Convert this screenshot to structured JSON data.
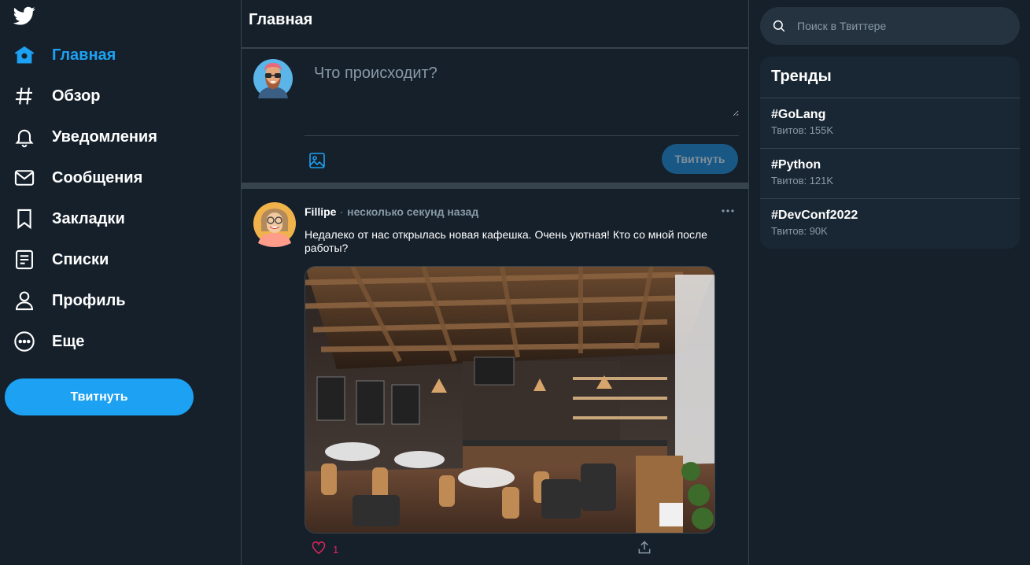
{
  "nav": {
    "items": [
      {
        "label": "Главная",
        "icon": "home-icon",
        "active": true
      },
      {
        "label": "Обзор",
        "icon": "hashtag-icon"
      },
      {
        "label": "Уведомления",
        "icon": "bell-icon"
      },
      {
        "label": "Сообщения",
        "icon": "mail-icon"
      },
      {
        "label": "Закладки",
        "icon": "bookmark-icon"
      },
      {
        "label": "Списки",
        "icon": "list-icon"
      },
      {
        "label": "Профиль",
        "icon": "user-icon"
      },
      {
        "label": "Еще",
        "icon": "more-circle-icon"
      }
    ],
    "tweet_button": "Твитнуть"
  },
  "center": {
    "title": "Главная",
    "compose": {
      "placeholder": "Что происходит?",
      "tweet_button": "Твитнуть"
    },
    "tweet": {
      "author": "Fillipe",
      "separator": "·",
      "time": "несколько секунд назад",
      "text": "Недалеко от нас открылась новая кафешка. Очень уютная! Кто со мной после работы?",
      "likes": "1"
    }
  },
  "sidebar": {
    "search_placeholder": "Поиск в Твиттере",
    "trends_title": "Тренды",
    "trends": [
      {
        "tag": "#GoLang",
        "count": "Твитов: 155K"
      },
      {
        "tag": "#Python",
        "count": "Твитов: 121K"
      },
      {
        "tag": "#DevConf2022",
        "count": "Твитов: 90K"
      }
    ]
  },
  "colors": {
    "background": "#15202b",
    "accent": "#1da1f2",
    "border": "#38444d",
    "muted": "#8899a6",
    "like": "#e0245e"
  }
}
